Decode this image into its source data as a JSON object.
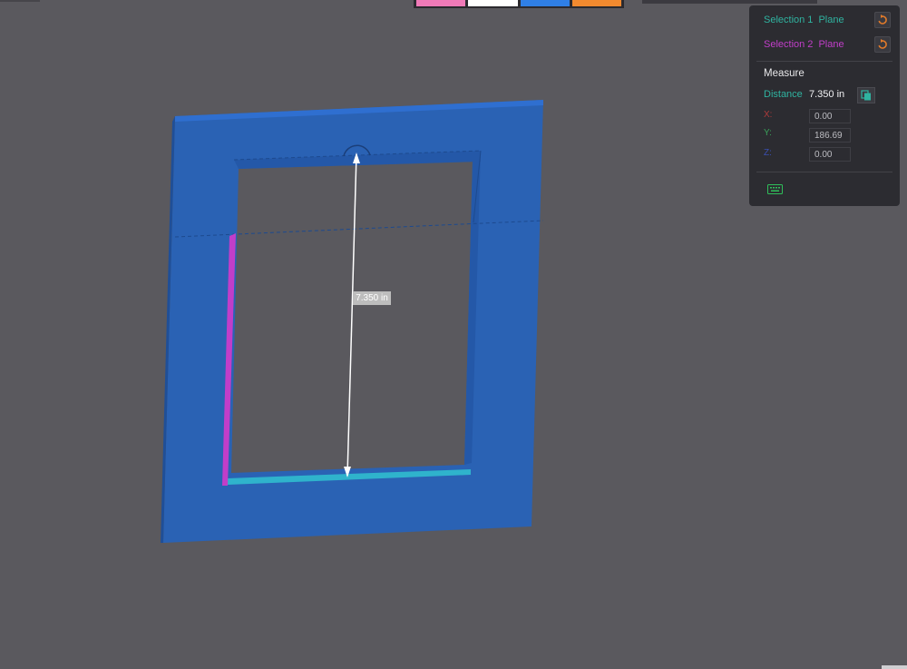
{
  "colors": {
    "background": "#5a595e",
    "part_face": "#2a62b4",
    "part_edge": "#1f4f98",
    "selection1": "#2fb3a0",
    "selection2": "#c13ec9",
    "accent_orange": "#e07a2a",
    "panel_bg": "#2c2c31"
  },
  "swatches": [
    "#f07ab8",
    "#ffffff",
    "#2f7fe6",
    "#f28a2f"
  ],
  "viewport": {
    "dimension_label": "7.350 in"
  },
  "measure_panel": {
    "selection1": {
      "label": "Selection 1",
      "type": "Plane",
      "reset_icon": "reset-icon"
    },
    "selection2": {
      "label": "Selection 2",
      "type": "Plane",
      "reset_icon": "reset-icon"
    },
    "title": "Measure",
    "distance_label": "Distance",
    "distance_value": "7.350 in",
    "copy_icon": "copy-icon",
    "x": {
      "label": "X:",
      "value": "0.00",
      "color": "#b03a3a"
    },
    "y": {
      "label": "Y:",
      "value": "186.69",
      "color": "#3aa05a"
    },
    "z": {
      "label": "Z:",
      "value": "0.00",
      "color": "#3a4fb0"
    },
    "keyboard_icon": "keyboard-icon"
  }
}
